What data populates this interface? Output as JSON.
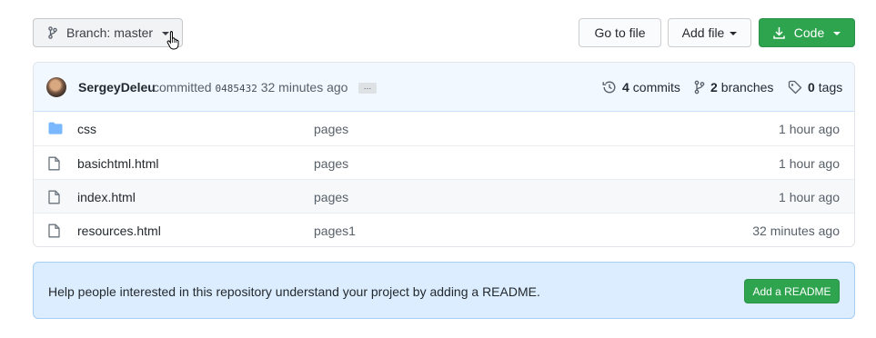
{
  "toolbar": {
    "branch_prefix": "Branch:",
    "branch_name": "master",
    "go_to_file": "Go to file",
    "add_file": "Add file",
    "code": "Code"
  },
  "commit_header": {
    "author": "SergeyDeleu",
    "action": "committed",
    "sha": "0485432",
    "time": "32 minutes ago",
    "ellipsis": "…",
    "commits_count": "4",
    "commits_label": "commits",
    "branches_count": "2",
    "branches_label": "branches",
    "tags_count": "0",
    "tags_label": "tags"
  },
  "files": [
    {
      "name": "css",
      "type": "folder",
      "message": "pages",
      "age": "1 hour ago"
    },
    {
      "name": "basichtml.html",
      "type": "file",
      "message": "pages",
      "age": "1 hour ago"
    },
    {
      "name": "index.html",
      "type": "file",
      "message": "pages",
      "age": "1 hour ago"
    },
    {
      "name": "resources.html",
      "type": "file",
      "message": "pages1",
      "age": "32 minutes ago"
    }
  ],
  "readme": {
    "text": "Help people interested in this repository understand your project by adding a README.",
    "button": "Add a README"
  },
  "colors": {
    "primary_green": "#2ea44f",
    "folder_blue": "#79b8ff",
    "header_bg": "#f1f8ff",
    "readme_bg": "#dbedff"
  },
  "icons": {
    "branch": "git-branch-icon",
    "download": "download-icon",
    "history": "history-icon",
    "tag": "tag-icon",
    "folder": "folder-icon",
    "file": "file-icon"
  }
}
